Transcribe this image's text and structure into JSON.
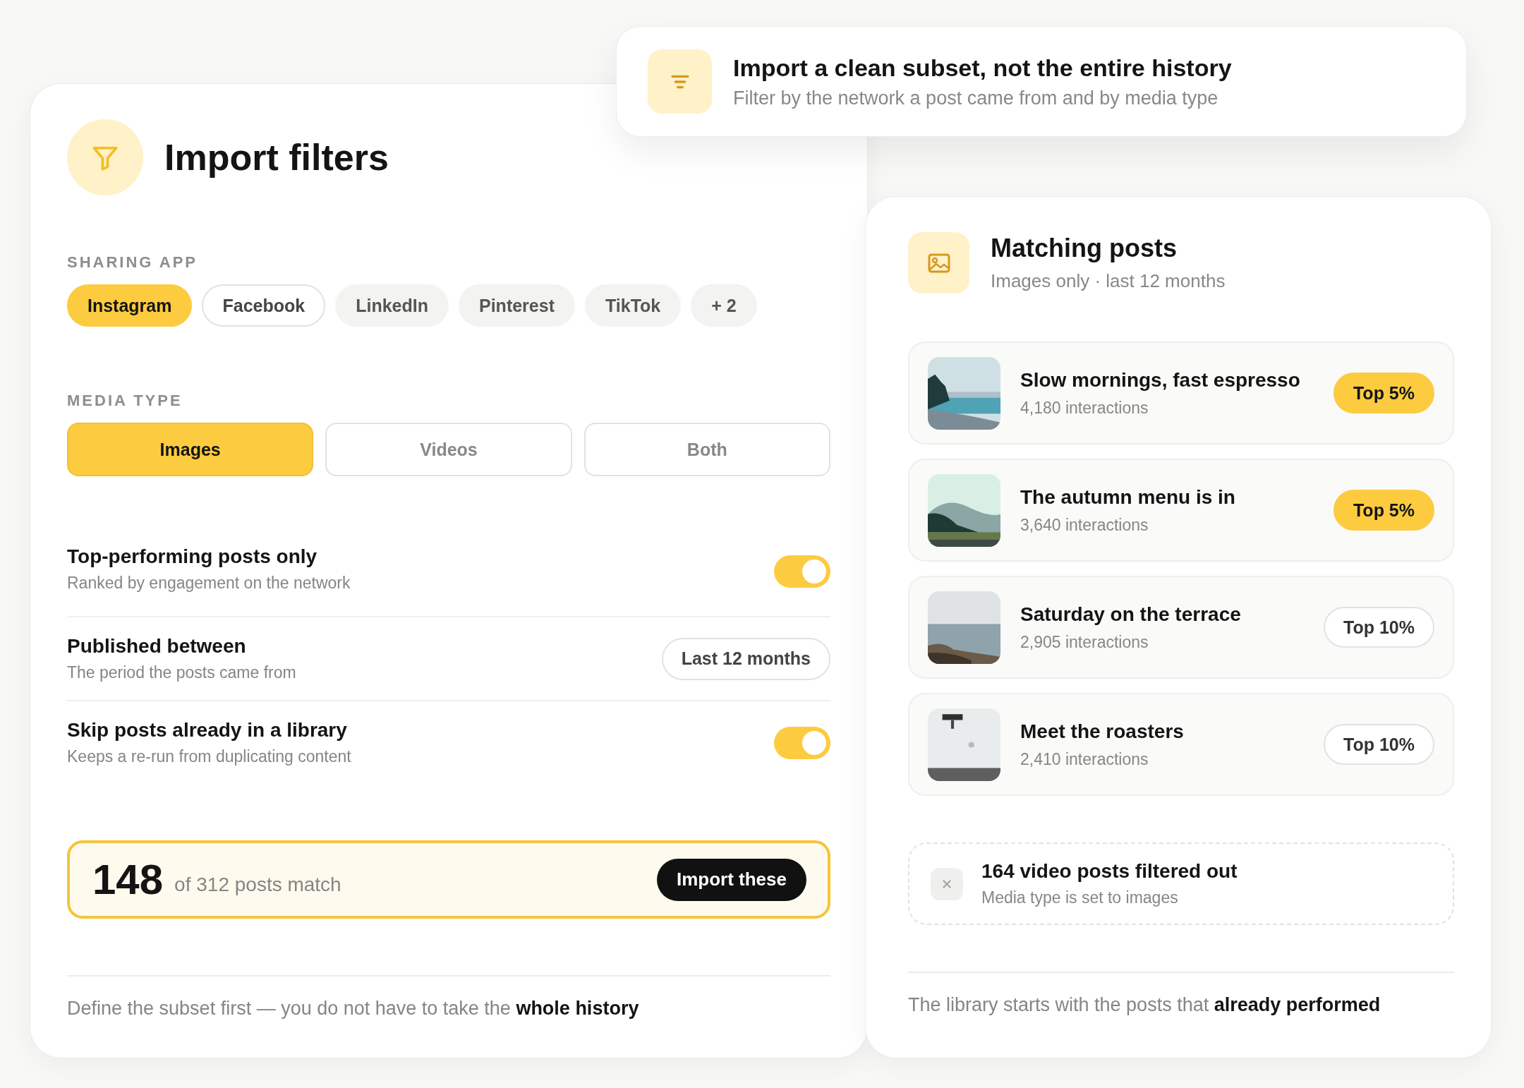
{
  "callout": {
    "title": "Import a clean subset, not the entire history",
    "subtitle": "Filter by the network a post came from and by media type"
  },
  "filters": {
    "title": "Import filters",
    "sharing_app": {
      "label": "SHARING APP",
      "options": [
        {
          "label": "Instagram",
          "selected": true,
          "kind": "filled"
        },
        {
          "label": "Facebook",
          "selected": false,
          "kind": "outline"
        },
        {
          "label": "LinkedIn",
          "selected": false,
          "kind": "filled"
        },
        {
          "label": "Pinterest",
          "selected": false,
          "kind": "filled"
        },
        {
          "label": "TikTok",
          "selected": false,
          "kind": "filled"
        },
        {
          "label": "+ 2",
          "selected": false,
          "kind": "filled"
        }
      ]
    },
    "media_type": {
      "label": "MEDIA TYPE",
      "options": [
        {
          "label": "Images",
          "selected": true
        },
        {
          "label": "Videos",
          "selected": false
        },
        {
          "label": "Both",
          "selected": false
        }
      ]
    },
    "settings": [
      {
        "kind": "toggle",
        "title": "Top-performing posts only",
        "description": "Ranked by engagement on the network",
        "on": true
      },
      {
        "kind": "select",
        "title": "Published between",
        "description": "The period the posts came from",
        "value": "Last 12 months"
      },
      {
        "kind": "toggle",
        "title": "Skip posts already in a library",
        "description": "Keeps a re-run from duplicating content",
        "on": true
      }
    ],
    "summary": {
      "count": "148",
      "text": "of 312 posts match",
      "button": "Import these"
    },
    "footer": "Define the subset first — you do not have to take the **whole history**"
  },
  "matching": {
    "title": "Matching posts",
    "subtitle": "Images only · last 12 months",
    "posts": [
      {
        "title": "Slow mornings, fast espresso",
        "interactions": "4,180 interactions",
        "badge": "Top 5%",
        "highlighted": true
      },
      {
        "title": "The autumn menu is in",
        "interactions": "3,640 interactions",
        "badge": "Top 5%",
        "highlighted": true
      },
      {
        "title": "Saturday on the terrace",
        "interactions": "2,905 interactions",
        "badge": "Top 10%",
        "highlighted": false
      },
      {
        "title": "Meet the roasters",
        "interactions": "2,410 interactions",
        "badge": "Top 10%",
        "highlighted": false
      }
    ],
    "excluded": {
      "title": "164 video posts filtered out",
      "subtitle": "Media type is set to images"
    },
    "footer": "The library starts with the posts that **already performed**"
  }
}
